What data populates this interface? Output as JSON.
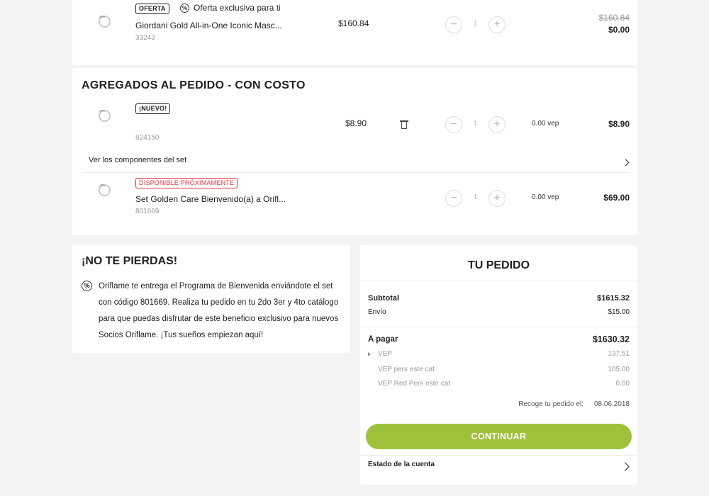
{
  "top_item": {
    "tag": "OFERTA",
    "offer_text": "Oferta exclusiva para ti",
    "name": "Giordani Gold All-in-One Iconic Masc...",
    "code": "33243",
    "price": "$160.84",
    "qty": "1",
    "original_total": "$160.84",
    "total": "$0.00"
  },
  "added_section": {
    "title": "AGREGADOS AL PEDIDO - CON COSTO",
    "items": [
      {
        "tag": "¡NUEVO!",
        "code": "824150",
        "price": "$8.90",
        "qty": "1",
        "vep": "0.00 vep",
        "total": "$8.90"
      },
      {
        "tag": "DISPONIBLE PRÓXIMAMENTE",
        "name": "Set Golden Care Bienvenido(a) a Orifl...",
        "code": "801669",
        "qty": "1",
        "vep": "0.00 vep",
        "total": "$69.00"
      }
    ],
    "set_link": "Ver los componentes del set"
  },
  "promo": {
    "title": "¡NO TE PIERDAS!",
    "text": "Oriflame te entrega el Programa de Bienvenida enviándote el set con código 801669. Realiza tu pedido en tu 2do 3er y 4to catálogo para que puedas disfrutar de este beneficio exclusivo para nuevos Socios Oriflame. ¡Tus sueños empiezan aquí!"
  },
  "summary": {
    "title": "TU PEDIDO",
    "subtotal_label": "Subtotal",
    "subtotal_value": "$1615.32",
    "shipping_label": "Envío",
    "shipping_value": "$15.00",
    "to_pay_label": "A pagar",
    "to_pay_value": "$1630.32",
    "vep_label": "VEP",
    "vep_value": "137.51",
    "vep_pers_label": "VEP pers este cat",
    "vep_pers_value": "105.00",
    "vep_red_label": "VEP Red Pers este cat",
    "vep_red_value": "0.00",
    "pickup_label": "Recoge tu pedido el:",
    "pickup_date": "08.06.2018",
    "continue_label": "CONTINUAR",
    "account_label": "Estado de la cuenta"
  },
  "icons": {
    "offer": "percent-circle-icon",
    "trash": "trash-icon",
    "chevron": "chevron-right-icon"
  },
  "colors": {
    "accent": "#9dc13b",
    "alert": "#e0363d",
    "background": "#f4f4f4"
  }
}
